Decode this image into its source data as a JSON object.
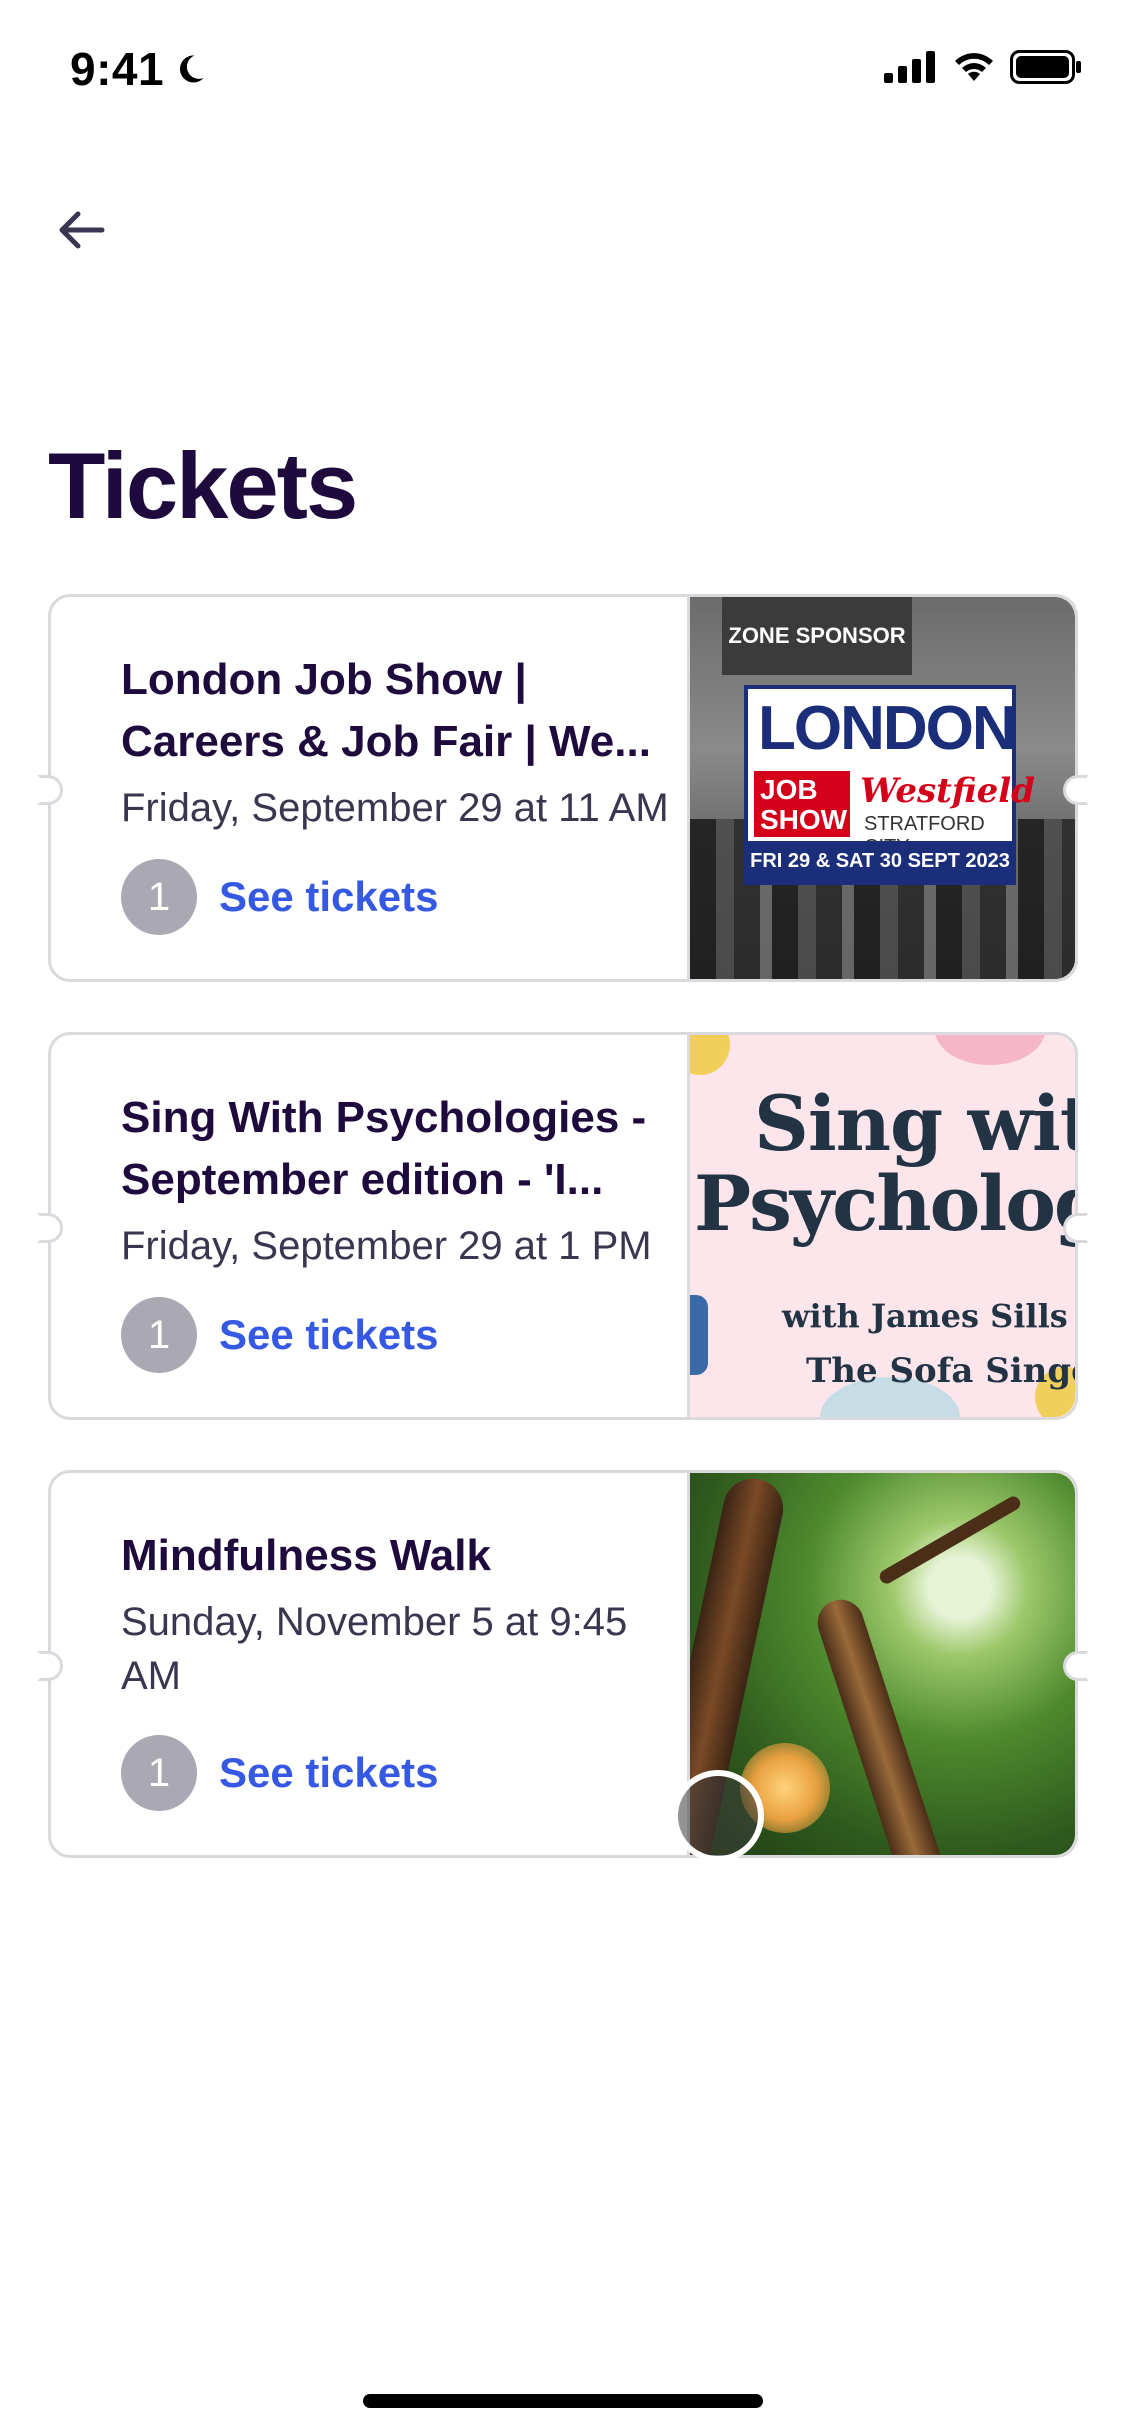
{
  "status_bar": {
    "time": "9:41"
  },
  "header": {
    "title": "Tickets"
  },
  "tickets": [
    {
      "title": "London Job Show | Careers & Job Fair | We...",
      "date": "Friday, September 29 at 11 AM",
      "quantity": "1",
      "action_label": "See tickets",
      "image": {
        "zone_label": "ZONE SPONSOR",
        "headline": "LONDON",
        "job_show": "JOB SHOW",
        "brand": "Westfield",
        "location": "STRATFORD CITY",
        "dates": "FRI 29 & SAT 30 SEPT 2023"
      }
    },
    {
      "title": "Sing With Psychologies - September edition - 'I...",
      "date": "Friday, September 29 at 1 PM",
      "quantity": "1",
      "action_label": "See tickets",
      "image": {
        "line1": "Sing wit",
        "line2": "Psycholog",
        "line3": "with James Sills",
        "line4": "The Sofa Singe"
      }
    },
    {
      "title": "Mindfulness Walk",
      "date": "Sunday, November 5 at 9:45 AM",
      "quantity": "1",
      "action_label": "See tickets"
    }
  ]
}
